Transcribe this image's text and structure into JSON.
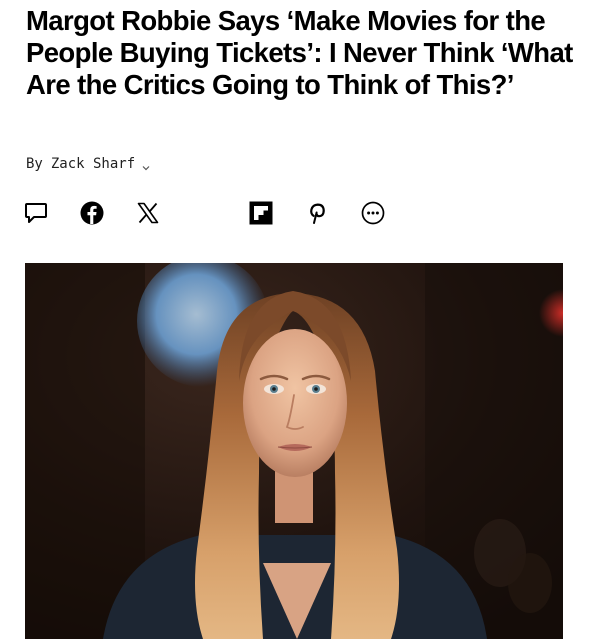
{
  "article": {
    "headline": "Margot Robbie Says ‘Make Movies for the People Buying Tickets’: I Never Think ‘What Are the Critics Going to Think of This?’",
    "byline": {
      "prefix": "By",
      "author": "Zack Sharf"
    }
  },
  "share": {
    "buttons": [
      {
        "icon": "speech-bubble-icon"
      },
      {
        "icon": "facebook-icon"
      },
      {
        "icon": "x-icon"
      },
      {
        "icon": "flipboard-icon"
      },
      {
        "icon": "pinterest-icon"
      },
      {
        "icon": "more-options-icon"
      }
    ]
  },
  "colors": {
    "text": "#000000",
    "byline": "#222222",
    "photo_background": "#1b0f0b"
  }
}
